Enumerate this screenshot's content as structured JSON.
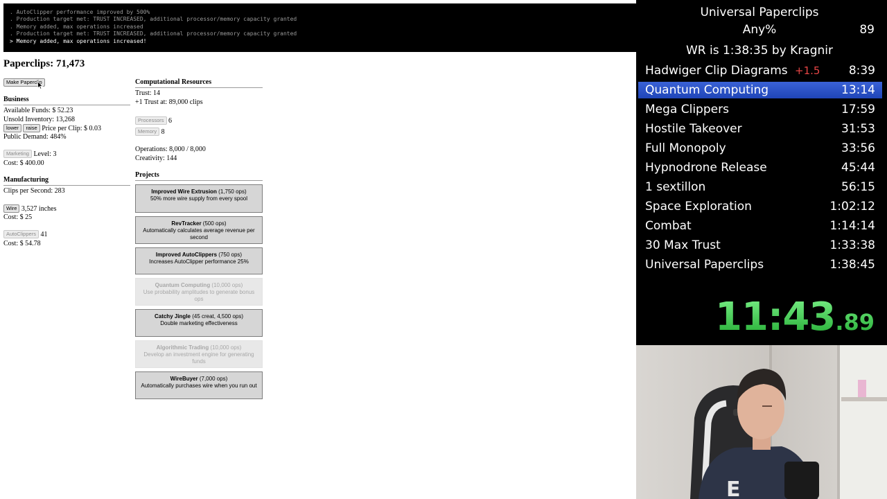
{
  "console": {
    "lines": [
      ". AutoClipper performance improved by 500%",
      ". Production target met: TRUST INCREASED, additional processor/memory capacity granted",
      ". Memory added, max operations increased",
      ". Production target met: TRUST INCREASED, additional processor/memory capacity granted",
      "> Memory added, max operations increased!"
    ]
  },
  "paperclips": {
    "title": "Paperclips: 71,473",
    "make_button": "Make Paperclip"
  },
  "business": {
    "header": "Business",
    "available_funds": "Available Funds: $ 52.23",
    "unsold_inventory": "Unsold Inventory: 13,268",
    "lower_button": "lower",
    "raise_button": "raise",
    "price_per_clip": "Price per Clip: $ 0.03",
    "public_demand": "Public Demand: 484%",
    "marketing_button": "Marketing",
    "marketing_level": "Level: 3",
    "marketing_cost": "Cost: $ 400.00"
  },
  "manufacturing": {
    "header": "Manufacturing",
    "clips_per_second": "Clips per Second: 283",
    "wire_button": "Wire",
    "wire_amount": "3,527 inches",
    "wire_cost": "Cost: $ 25",
    "autoclippers_button": "AutoClippers",
    "autoclippers_count": "41",
    "autoclippers_cost": "Cost: $ 54.78"
  },
  "computational": {
    "header": "Computational Resources",
    "trust": "Trust: 14",
    "next_trust": "+1 Trust at: 89,000 clips",
    "processors_button": "Processors",
    "processors_value": "6",
    "memory_button": "Memory",
    "memory_value": "8",
    "operations": "Operations: 8,000 / 8,000",
    "creativity": "Creativity: 144"
  },
  "projects": {
    "header": "Projects",
    "items": [
      {
        "name": "Improved Wire Extrusion",
        "cost": " (1,750 ops)",
        "desc": "50% more wire supply from every spool",
        "enabled": true
      },
      {
        "name": "RevTracker",
        "cost": " (500 ops)",
        "desc": "Automatically calculates average revenue per second",
        "enabled": true
      },
      {
        "name": "Improved AutoClippers",
        "cost": " (750 ops)",
        "desc": "Increases AutoClipper performance 25%",
        "enabled": true
      },
      {
        "name": "Quantum Computing",
        "cost": " (10,000 ops)",
        "desc": "Use probability amplitudes to generate bonus ops",
        "enabled": false
      },
      {
        "name": "Catchy Jingle",
        "cost": " (45 creat, 4,500 ops)",
        "desc": "Double marketing effectiveness",
        "enabled": true
      },
      {
        "name": "Algorithmic Trading",
        "cost": " (10,000 ops)",
        "desc": "Develop an investment engine for generating funds",
        "enabled": false
      },
      {
        "name": "WireBuyer",
        "cost": " (7,000 ops)",
        "desc": "Automatically purchases wire when you run out",
        "enabled": true
      }
    ]
  },
  "splits": {
    "game_title": "Universal Paperclips",
    "category": "Any%",
    "attempts": "89",
    "world_record": "WR is 1:38:35 by Kragnir",
    "items": [
      {
        "name": "Hadwiger Clip Diagrams",
        "delta": "+1.5",
        "time": "8:39",
        "active": false
      },
      {
        "name": "Quantum Computing",
        "delta": "",
        "time": "13:14",
        "active": true
      },
      {
        "name": "Mega Clippers",
        "delta": "",
        "time": "17:59",
        "active": false
      },
      {
        "name": "Hostile Takeover",
        "delta": "",
        "time": "31:53",
        "active": false
      },
      {
        "name": "Full Monopoly",
        "delta": "",
        "time": "33:56",
        "active": false
      },
      {
        "name": "Hypnodrone Release",
        "delta": "",
        "time": "45:44",
        "active": false
      },
      {
        "name": "1 sextillon",
        "delta": "",
        "time": "56:15",
        "active": false
      },
      {
        "name": "Space Exploration",
        "delta": "",
        "time": "1:02:12",
        "active": false
      },
      {
        "name": "Combat",
        "delta": "",
        "time": "1:14:14",
        "active": false
      },
      {
        "name": "30 Max Trust",
        "delta": "",
        "time": "1:33:38",
        "active": false
      },
      {
        "name": "Universal Paperclips",
        "delta": "",
        "time": "1:38:45",
        "active": false
      }
    ],
    "timer_main": "11:43",
    "timer_ms": ".89",
    "timer_color": "#3fd44e",
    "active_color": "#2b55c9",
    "delta_color": "#e64545"
  }
}
